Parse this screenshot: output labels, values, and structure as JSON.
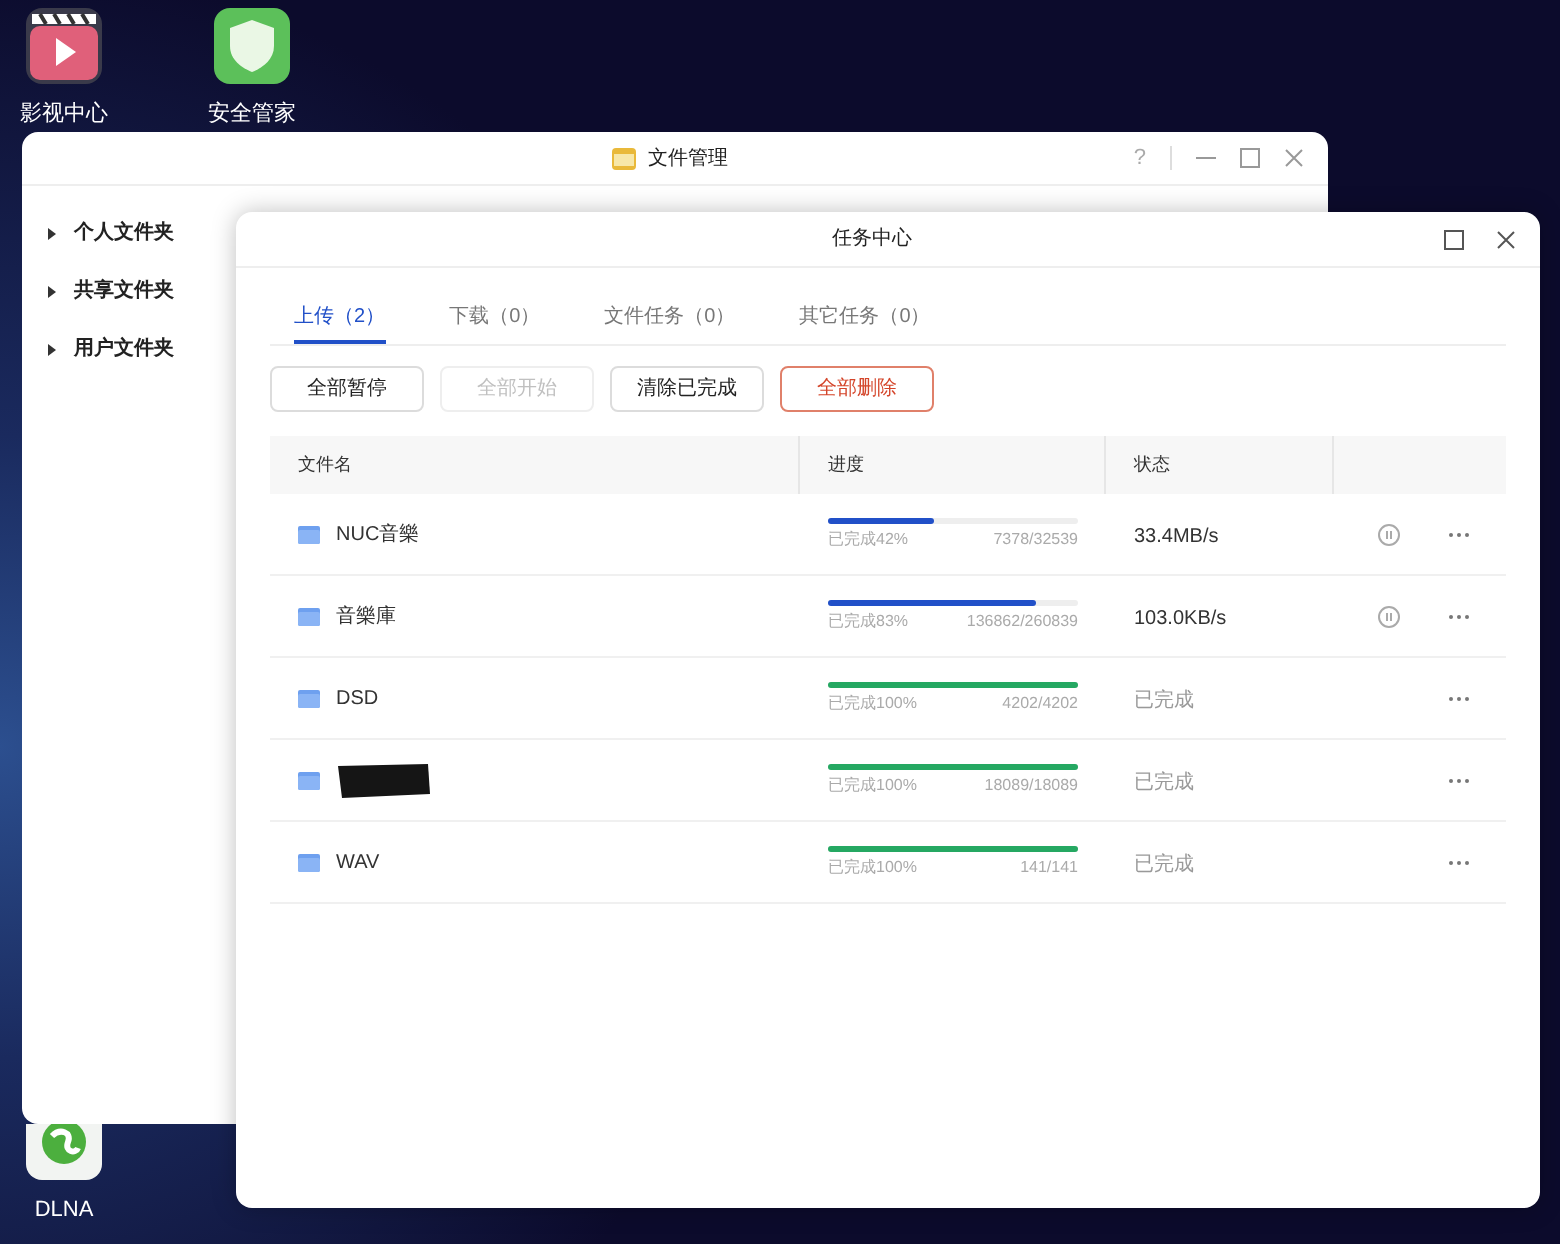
{
  "desktop_icons": [
    {
      "label": "影视中心",
      "kind": "video"
    },
    {
      "label": "安全管家",
      "kind": "shield"
    },
    {
      "label": "DLNA",
      "kind": "dlna"
    }
  ],
  "file_manager": {
    "title": "文件管理",
    "sidebar": {
      "items": [
        {
          "label": "个人文件夹",
          "expanded": false
        },
        {
          "label": "共享文件夹",
          "expanded": false
        },
        {
          "label": "用户文件夹",
          "expanded": false
        }
      ]
    },
    "help": "?"
  },
  "task_center": {
    "title": "任务中心",
    "tabs": [
      {
        "label": "上传（2）",
        "selected": true
      },
      {
        "label": "下载（0）",
        "selected": false
      },
      {
        "label": "文件任务（0）",
        "selected": false
      },
      {
        "label": "其它任务（0）",
        "selected": false
      }
    ],
    "buttons": [
      {
        "label": "全部暂停",
        "kind": "normal"
      },
      {
        "label": "全部开始",
        "kind": "disabled"
      },
      {
        "label": "清除已完成",
        "kind": "normal"
      },
      {
        "label": "全部删除",
        "kind": "danger"
      }
    ],
    "table": {
      "columns": [
        "文件名",
        "进度",
        "状态"
      ],
      "rows": [
        {
          "name": "NUC音樂",
          "redacted": false,
          "kind": "active",
          "level": 0.42,
          "progress": "已完成42%",
          "count": "7378/32539",
          "status": "33.4MB/s"
        },
        {
          "name": "音樂庫",
          "redacted": false,
          "kind": "active",
          "level": 0.83,
          "progress": "已完成83%",
          "count": "136862/260839",
          "status": "103.0KB/s"
        },
        {
          "name": "DSD",
          "redacted": false,
          "kind": "done",
          "level": 1,
          "progress": "已完成100%",
          "count": "4202/4202",
          "status": "已完成"
        },
        {
          "redacted": true,
          "kind": "done",
          "level": 1,
          "progress": "已完成100%",
          "count": "18089/18089",
          "status": "已完成"
        },
        {
          "name": "WAV",
          "redacted": false,
          "kind": "done",
          "level": 1,
          "progress": "已完成100%",
          "count": "141/141",
          "status": "已完成"
        }
      ]
    }
  }
}
